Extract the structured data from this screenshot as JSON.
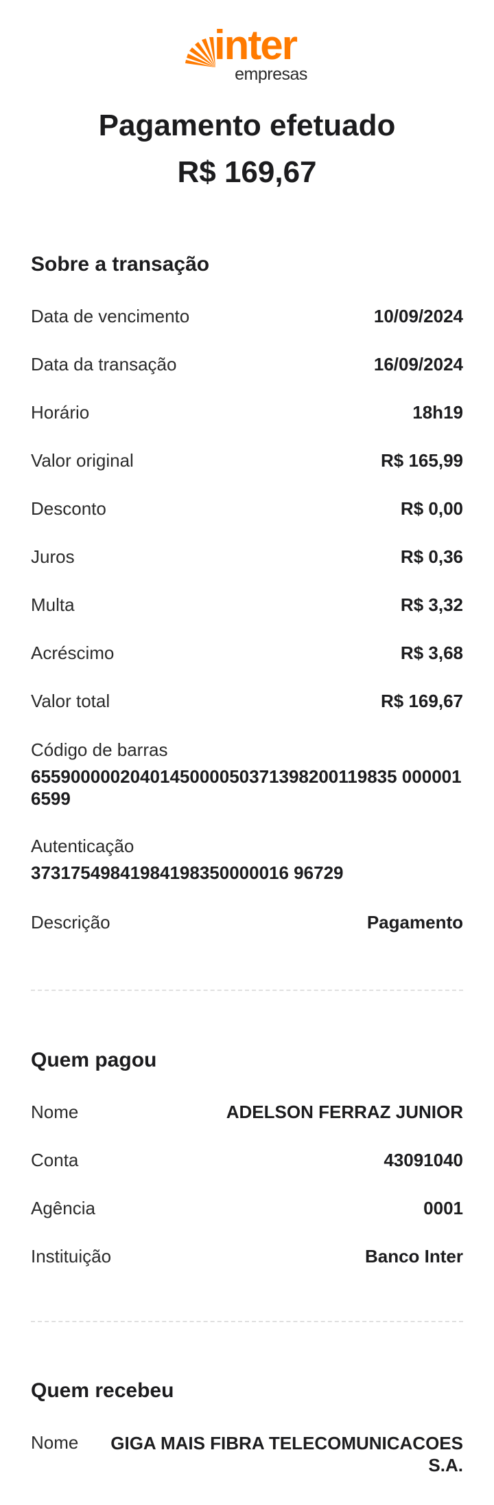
{
  "brand": {
    "name": "inter",
    "sub": "empresas",
    "color": "#ff7a00",
    "icon": "sun-rays-icon"
  },
  "header": {
    "title": "Pagamento efetuado",
    "amount": "R$ 169,67"
  },
  "transaction": {
    "section_title": "Sobre a transação",
    "rows": [
      {
        "label": "Data de vencimento",
        "value": "10/09/2024"
      },
      {
        "label": "Data da transação",
        "value": "16/09/2024"
      },
      {
        "label": "Horário",
        "value": "18h19"
      },
      {
        "label": "Valor original",
        "value": "R$ 165,99"
      },
      {
        "label": "Desconto",
        "value": "R$ 0,00"
      },
      {
        "label": "Juros",
        "value": "R$ 0,36"
      },
      {
        "label": "Multa",
        "value": "R$ 3,32"
      },
      {
        "label": "Acréscimo",
        "value": "R$ 3,68"
      },
      {
        "label": "Valor total",
        "value": "R$ 169,67"
      }
    ],
    "barcode_label": "Código de barras",
    "barcode_value": "6559000002040145000050371398200119835 0000016599",
    "auth_label": "Autenticação",
    "auth_value": "37317549841984198350000016 96729",
    "description_label": "Descrição",
    "description_value": "Pagamento"
  },
  "payer": {
    "section_title": "Quem pagou",
    "rows": [
      {
        "label": "Nome",
        "value": "ADELSON FERRAZ JUNIOR"
      },
      {
        "label": "Conta",
        "value": "43091040"
      },
      {
        "label": "Agência",
        "value": "0001"
      },
      {
        "label": "Instituição",
        "value": "Banco Inter"
      }
    ]
  },
  "receiver": {
    "section_title": "Quem recebeu",
    "rows": [
      {
        "label": "Nome",
        "value": "GIGA MAIS FIBRA TELECOMUNICACOES S.A."
      }
    ]
  }
}
